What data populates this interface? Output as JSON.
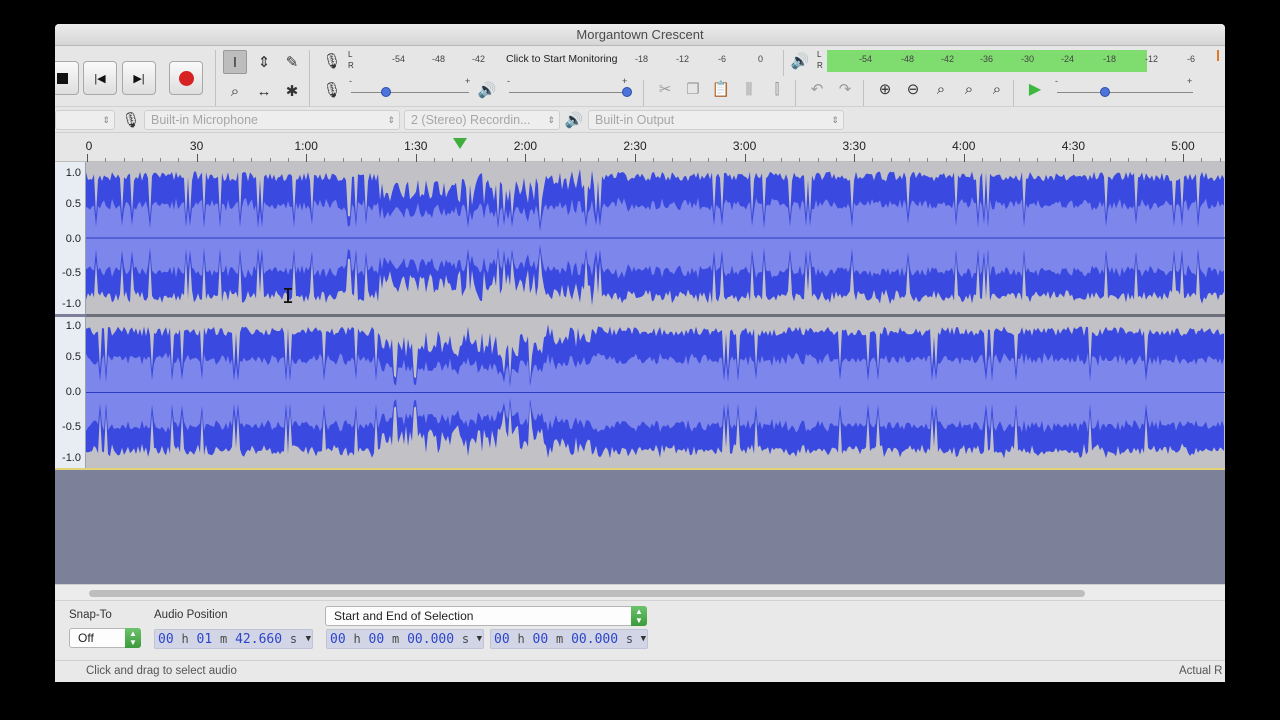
{
  "window": {
    "title": "Morgantown Crescent"
  },
  "transport": {
    "stop_icon": "stop-icon",
    "skip_start_icon": "skip-to-start-icon",
    "skip_end_icon": "skip-to-end-icon",
    "record_icon": "record-icon",
    "record_color": "#d62222"
  },
  "tools": [
    "selection-tool",
    "envelope-tool",
    "draw-tool",
    "zoom-tool",
    "time-shift-tool",
    "multi-tool"
  ],
  "recording_meter": {
    "channels": [
      "L",
      "R"
    ],
    "scale": [
      "-54",
      "-48",
      "-42",
      "-18",
      "-12",
      "-6",
      "0"
    ],
    "hint": "Click to Start Monitoring"
  },
  "playback_meter": {
    "channels": [
      "L",
      "R"
    ],
    "scale": [
      "-54",
      "-48",
      "-42",
      "-36",
      "-30",
      "-24",
      "-18",
      "-12",
      "-6"
    ],
    "level_color": "#7fdc6e",
    "level_fraction": 0.89
  },
  "mixer": {
    "input_min": "-",
    "input_max": "+",
    "input_level": 0.3,
    "output_min": "-",
    "output_max": "+",
    "output_level": 1.0
  },
  "play_at_speed": {
    "min": "-",
    "max": "+",
    "level": 0.35,
    "play_color": "#3fb83f"
  },
  "devices": {
    "host": "",
    "input": "Built-in Microphone",
    "channels": "2 (Stereo) Recordin...",
    "output": "Built-in Output"
  },
  "ruler": {
    "labels": [
      "0",
      "30",
      "1:00",
      "1:30",
      "2:00",
      "2:30",
      "3:00",
      "3:30",
      "4:00",
      "4:30",
      "5:00"
    ],
    "playhead_color": "#3fae3f"
  },
  "track": {
    "scale": [
      "1.0",
      "0.5",
      "0.0",
      "-0.5",
      "-1.0"
    ],
    "wave_color": "#3a49e0",
    "rms_color": "#7d86ea"
  },
  "selection_toolbar": {
    "snap_label": "Snap-To",
    "snap_value": "Off",
    "audio_position_label": "Audio Position",
    "audio_position": {
      "h": "00",
      "m": "01",
      "s": "42.660"
    },
    "selection_mode": "Start and End of Selection",
    "selection_start": {
      "h": "00",
      "m": "00",
      "s": "00.000"
    },
    "selection_end": {
      "h": "00",
      "m": "00",
      "s": "00.000"
    },
    "unit_h": "h",
    "unit_m": "m",
    "unit_s": "s"
  },
  "status": {
    "message": "Click and drag to select audio",
    "rate_label": "Actual R"
  }
}
